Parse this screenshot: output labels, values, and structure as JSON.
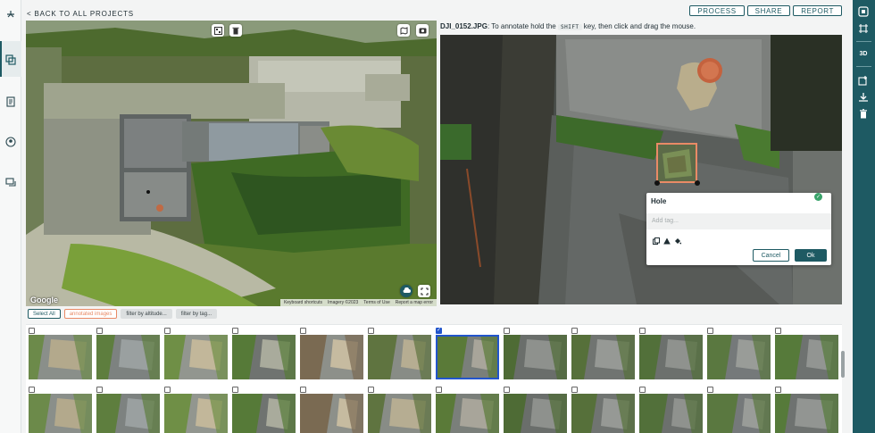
{
  "nav": {
    "back_label": "< BACK TO ALL PROJECTS"
  },
  "header_actions": [
    "PROCESS",
    "SHARE",
    "REPORT"
  ],
  "map": {
    "google_label": "Google",
    "footer": [
      "Keyboard shortcuts",
      "Imagery ©2023",
      "Terms of Use",
      "Report a map error"
    ]
  },
  "viewer": {
    "filename": "DJI_0152.JPG",
    "instruction_before": ": To annotate hold the",
    "shift_key": "SHIFT",
    "instruction_after": "key, then click and drag the mouse."
  },
  "annotation_popup": {
    "title": "Hole",
    "tag_placeholder": "Add tag...",
    "cancel_label": "Cancel",
    "ok_label": "Ok"
  },
  "filters": {
    "select_all": "Select All",
    "annotated": "annotated images",
    "by_altitude": "filter by altitude...",
    "by_tag": "filter by tag..."
  },
  "right_rail": {
    "mode_3d": "3D"
  },
  "gallery": {
    "columns": 12,
    "rows": 2,
    "selected_index": 6
  },
  "colors": {
    "brand": "#1e5a63",
    "accent": "#e98a66",
    "selection": "#2255cc"
  }
}
